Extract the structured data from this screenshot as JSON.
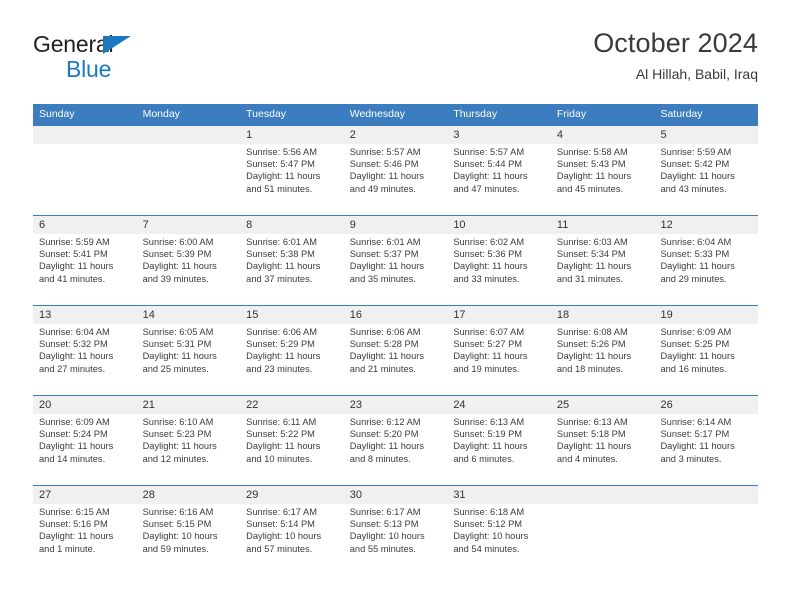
{
  "brand": {
    "line1": "General",
    "line2": "Blue",
    "triangle_color": "#1c79c0"
  },
  "header": {
    "title": "October 2024",
    "subtitle": "Al Hillah, Babil, Iraq"
  },
  "theme": {
    "header_blue": "#3b7dbf",
    "daynum_band": "#f0f0f0",
    "text": "#3c3c3c"
  },
  "weekdays": [
    "Sunday",
    "Monday",
    "Tuesday",
    "Wednesday",
    "Thursday",
    "Friday",
    "Saturday"
  ],
  "weeks": [
    [
      {
        "day": "",
        "sunrise": "",
        "sunset": "",
        "daylight1": "",
        "daylight2": ""
      },
      {
        "day": "",
        "sunrise": "",
        "sunset": "",
        "daylight1": "",
        "daylight2": ""
      },
      {
        "day": "1",
        "sunrise": "Sunrise: 5:56 AM",
        "sunset": "Sunset: 5:47 PM",
        "daylight1": "Daylight: 11 hours",
        "daylight2": "and 51 minutes."
      },
      {
        "day": "2",
        "sunrise": "Sunrise: 5:57 AM",
        "sunset": "Sunset: 5:46 PM",
        "daylight1": "Daylight: 11 hours",
        "daylight2": "and 49 minutes."
      },
      {
        "day": "3",
        "sunrise": "Sunrise: 5:57 AM",
        "sunset": "Sunset: 5:44 PM",
        "daylight1": "Daylight: 11 hours",
        "daylight2": "and 47 minutes."
      },
      {
        "day": "4",
        "sunrise": "Sunrise: 5:58 AM",
        "sunset": "Sunset: 5:43 PM",
        "daylight1": "Daylight: 11 hours",
        "daylight2": "and 45 minutes."
      },
      {
        "day": "5",
        "sunrise": "Sunrise: 5:59 AM",
        "sunset": "Sunset: 5:42 PM",
        "daylight1": "Daylight: 11 hours",
        "daylight2": "and 43 minutes."
      }
    ],
    [
      {
        "day": "6",
        "sunrise": "Sunrise: 5:59 AM",
        "sunset": "Sunset: 5:41 PM",
        "daylight1": "Daylight: 11 hours",
        "daylight2": "and 41 minutes."
      },
      {
        "day": "7",
        "sunrise": "Sunrise: 6:00 AM",
        "sunset": "Sunset: 5:39 PM",
        "daylight1": "Daylight: 11 hours",
        "daylight2": "and 39 minutes."
      },
      {
        "day": "8",
        "sunrise": "Sunrise: 6:01 AM",
        "sunset": "Sunset: 5:38 PM",
        "daylight1": "Daylight: 11 hours",
        "daylight2": "and 37 minutes."
      },
      {
        "day": "9",
        "sunrise": "Sunrise: 6:01 AM",
        "sunset": "Sunset: 5:37 PM",
        "daylight1": "Daylight: 11 hours",
        "daylight2": "and 35 minutes."
      },
      {
        "day": "10",
        "sunrise": "Sunrise: 6:02 AM",
        "sunset": "Sunset: 5:36 PM",
        "daylight1": "Daylight: 11 hours",
        "daylight2": "and 33 minutes."
      },
      {
        "day": "11",
        "sunrise": "Sunrise: 6:03 AM",
        "sunset": "Sunset: 5:34 PM",
        "daylight1": "Daylight: 11 hours",
        "daylight2": "and 31 minutes."
      },
      {
        "day": "12",
        "sunrise": "Sunrise: 6:04 AM",
        "sunset": "Sunset: 5:33 PM",
        "daylight1": "Daylight: 11 hours",
        "daylight2": "and 29 minutes."
      }
    ],
    [
      {
        "day": "13",
        "sunrise": "Sunrise: 6:04 AM",
        "sunset": "Sunset: 5:32 PM",
        "daylight1": "Daylight: 11 hours",
        "daylight2": "and 27 minutes."
      },
      {
        "day": "14",
        "sunrise": "Sunrise: 6:05 AM",
        "sunset": "Sunset: 5:31 PM",
        "daylight1": "Daylight: 11 hours",
        "daylight2": "and 25 minutes."
      },
      {
        "day": "15",
        "sunrise": "Sunrise: 6:06 AM",
        "sunset": "Sunset: 5:29 PM",
        "daylight1": "Daylight: 11 hours",
        "daylight2": "and 23 minutes."
      },
      {
        "day": "16",
        "sunrise": "Sunrise: 6:06 AM",
        "sunset": "Sunset: 5:28 PM",
        "daylight1": "Daylight: 11 hours",
        "daylight2": "and 21 minutes."
      },
      {
        "day": "17",
        "sunrise": "Sunrise: 6:07 AM",
        "sunset": "Sunset: 5:27 PM",
        "daylight1": "Daylight: 11 hours",
        "daylight2": "and 19 minutes."
      },
      {
        "day": "18",
        "sunrise": "Sunrise: 6:08 AM",
        "sunset": "Sunset: 5:26 PM",
        "daylight1": "Daylight: 11 hours",
        "daylight2": "and 18 minutes."
      },
      {
        "day": "19",
        "sunrise": "Sunrise: 6:09 AM",
        "sunset": "Sunset: 5:25 PM",
        "daylight1": "Daylight: 11 hours",
        "daylight2": "and 16 minutes."
      }
    ],
    [
      {
        "day": "20",
        "sunrise": "Sunrise: 6:09 AM",
        "sunset": "Sunset: 5:24 PM",
        "daylight1": "Daylight: 11 hours",
        "daylight2": "and 14 minutes."
      },
      {
        "day": "21",
        "sunrise": "Sunrise: 6:10 AM",
        "sunset": "Sunset: 5:23 PM",
        "daylight1": "Daylight: 11 hours",
        "daylight2": "and 12 minutes."
      },
      {
        "day": "22",
        "sunrise": "Sunrise: 6:11 AM",
        "sunset": "Sunset: 5:22 PM",
        "daylight1": "Daylight: 11 hours",
        "daylight2": "and 10 minutes."
      },
      {
        "day": "23",
        "sunrise": "Sunrise: 6:12 AM",
        "sunset": "Sunset: 5:20 PM",
        "daylight1": "Daylight: 11 hours",
        "daylight2": "and 8 minutes."
      },
      {
        "day": "24",
        "sunrise": "Sunrise: 6:13 AM",
        "sunset": "Sunset: 5:19 PM",
        "daylight1": "Daylight: 11 hours",
        "daylight2": "and 6 minutes."
      },
      {
        "day": "25",
        "sunrise": "Sunrise: 6:13 AM",
        "sunset": "Sunset: 5:18 PM",
        "daylight1": "Daylight: 11 hours",
        "daylight2": "and 4 minutes."
      },
      {
        "day": "26",
        "sunrise": "Sunrise: 6:14 AM",
        "sunset": "Sunset: 5:17 PM",
        "daylight1": "Daylight: 11 hours",
        "daylight2": "and 3 minutes."
      }
    ],
    [
      {
        "day": "27",
        "sunrise": "Sunrise: 6:15 AM",
        "sunset": "Sunset: 5:16 PM",
        "daylight1": "Daylight: 11 hours",
        "daylight2": "and 1 minute."
      },
      {
        "day": "28",
        "sunrise": "Sunrise: 6:16 AM",
        "sunset": "Sunset: 5:15 PM",
        "daylight1": "Daylight: 10 hours",
        "daylight2": "and 59 minutes."
      },
      {
        "day": "29",
        "sunrise": "Sunrise: 6:17 AM",
        "sunset": "Sunset: 5:14 PM",
        "daylight1": "Daylight: 10 hours",
        "daylight2": "and 57 minutes."
      },
      {
        "day": "30",
        "sunrise": "Sunrise: 6:17 AM",
        "sunset": "Sunset: 5:13 PM",
        "daylight1": "Daylight: 10 hours",
        "daylight2": "and 55 minutes."
      },
      {
        "day": "31",
        "sunrise": "Sunrise: 6:18 AM",
        "sunset": "Sunset: 5:12 PM",
        "daylight1": "Daylight: 10 hours",
        "daylight2": "and 54 minutes."
      },
      {
        "day": "",
        "sunrise": "",
        "sunset": "",
        "daylight1": "",
        "daylight2": ""
      },
      {
        "day": "",
        "sunrise": "",
        "sunset": "",
        "daylight1": "",
        "daylight2": ""
      }
    ]
  ]
}
